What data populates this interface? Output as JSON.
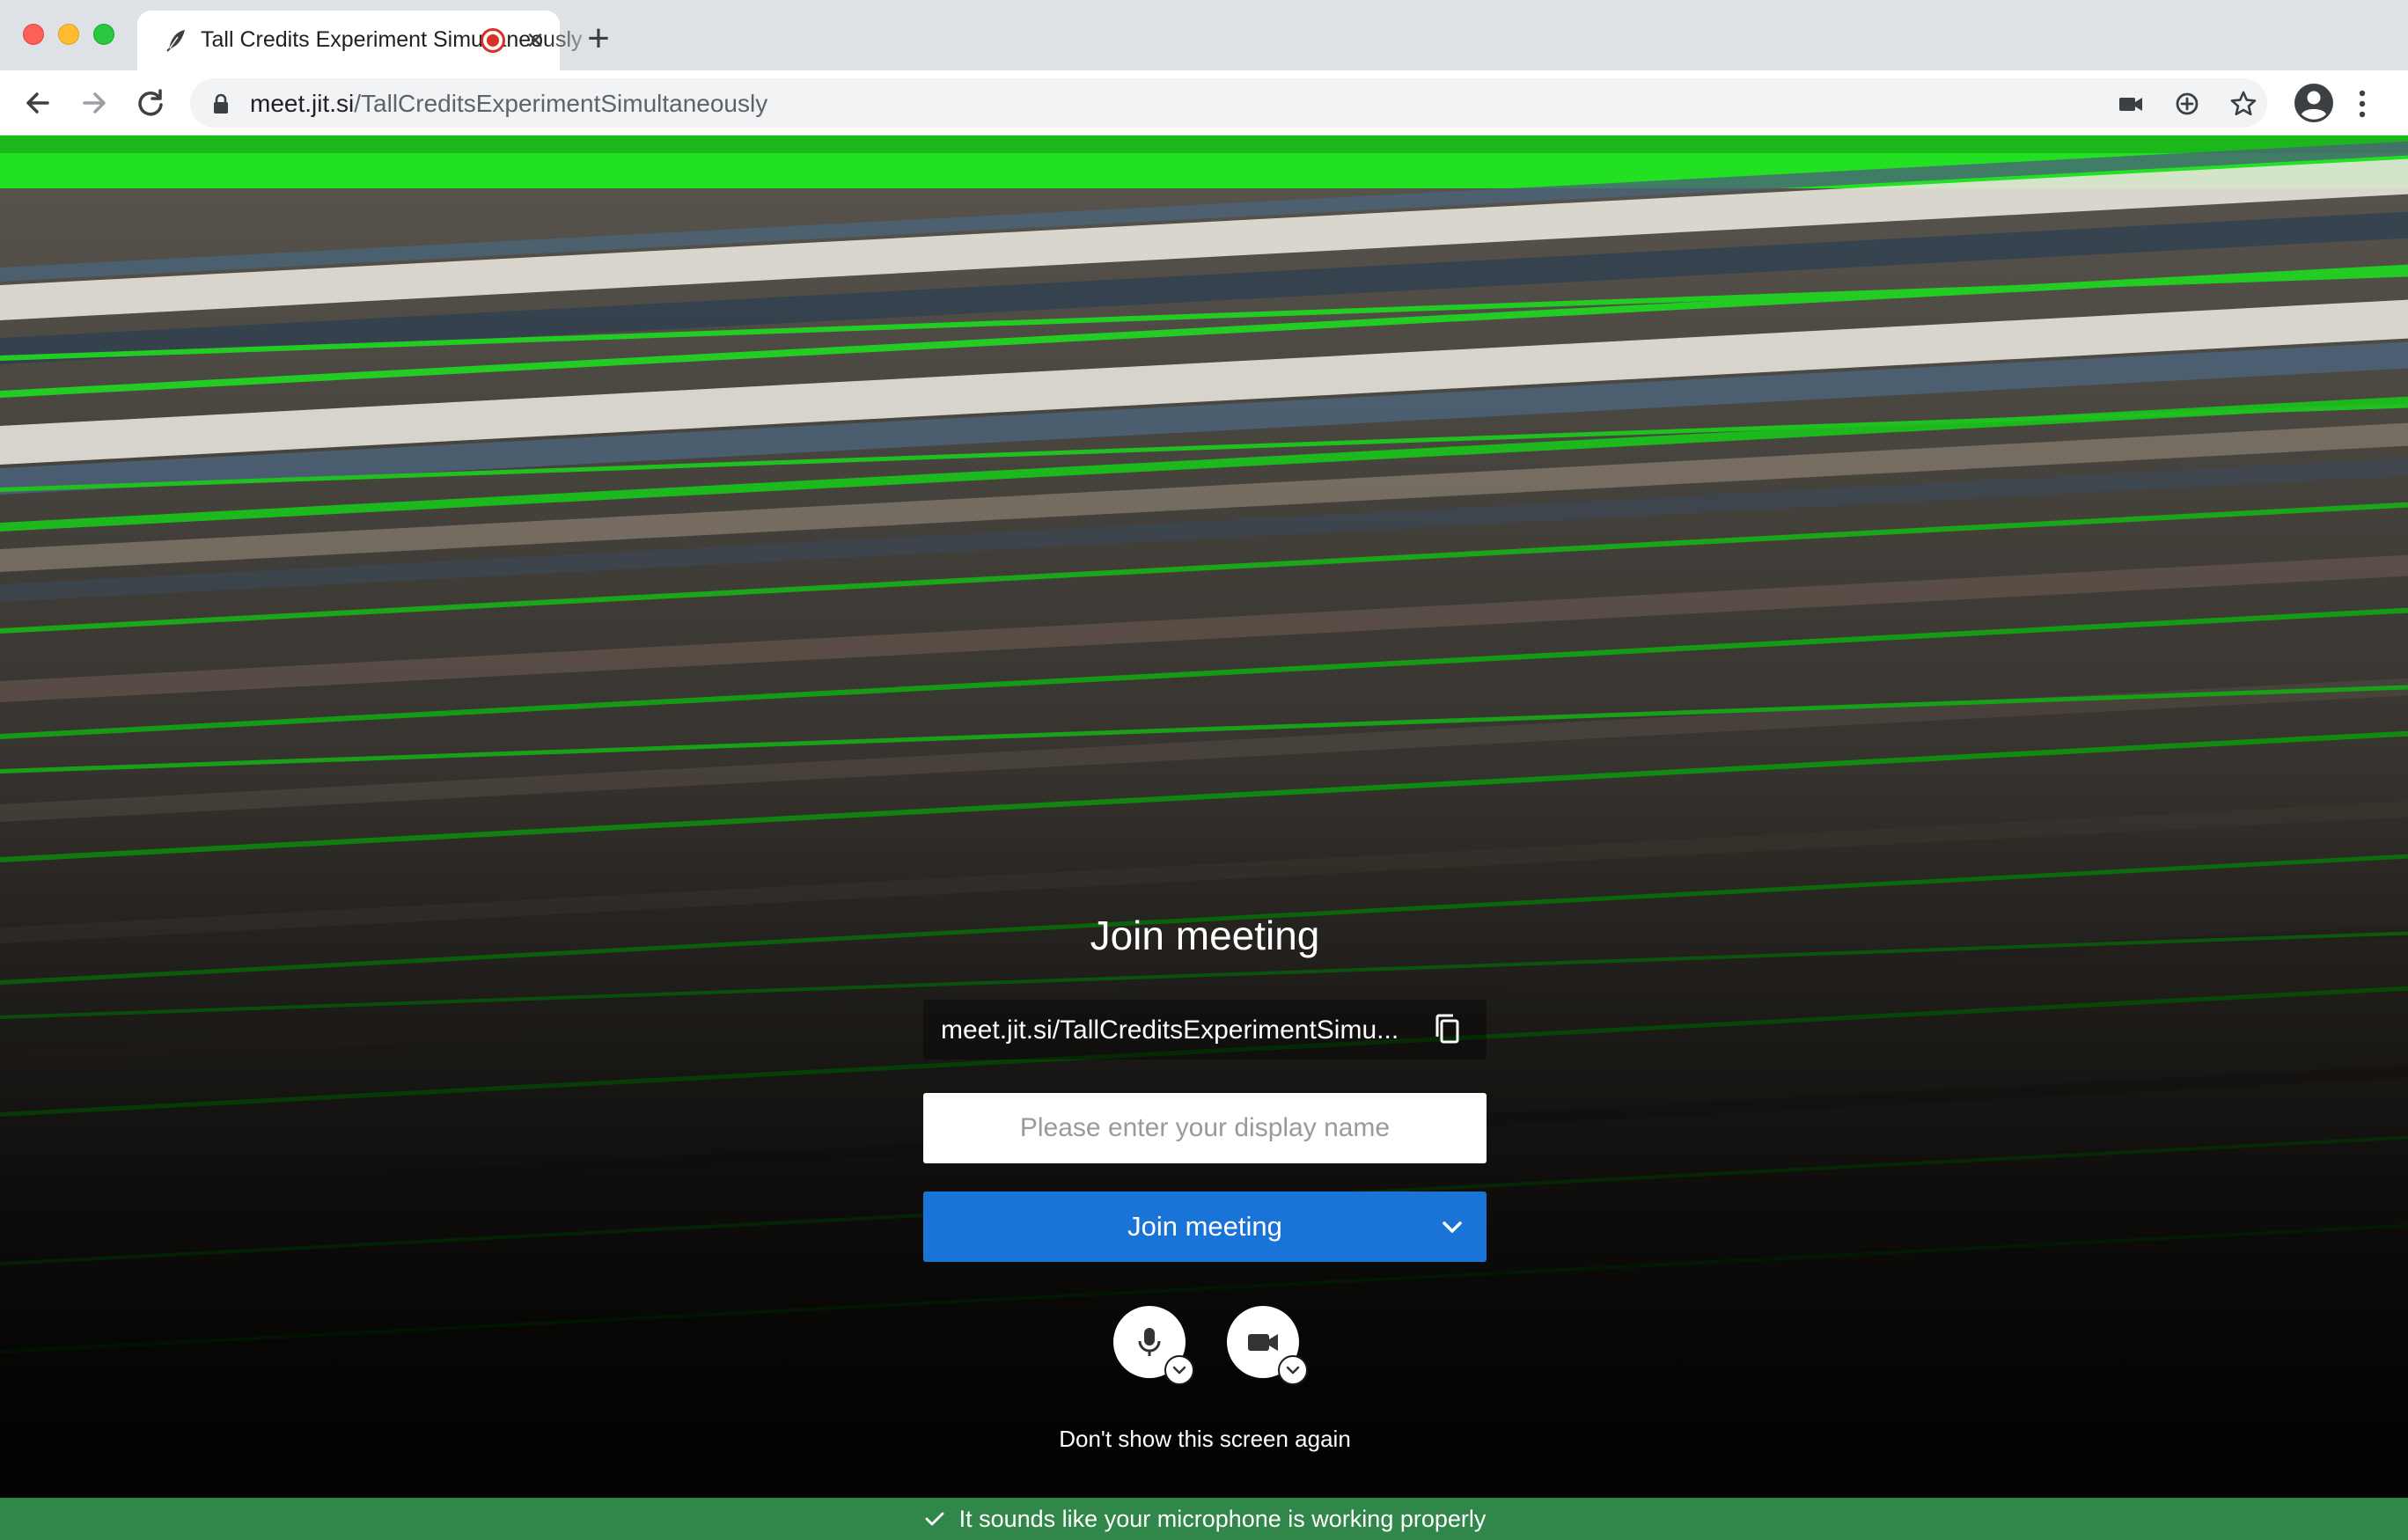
{
  "browser": {
    "tab": {
      "title": "Tall Credits Experiment Simultaneously",
      "close_icon": "×",
      "favicon": "jitsi-favicon-icon",
      "recording_indicator": "recording-dot-icon"
    },
    "new_tab_icon": "+",
    "address": {
      "host": "meet.jit.si",
      "path": "/TallCreditsExperimentSimultaneously"
    },
    "toolbar_icons": [
      "back-arrow-icon",
      "forward-arrow-icon",
      "reload-icon",
      "lock-icon",
      "camera-icon",
      "add-icon",
      "star-icon",
      "profile-icon",
      "kebab-menu-icon"
    ]
  },
  "prejoin": {
    "title": "Join meeting",
    "room_url": "meet.jit.si/TallCreditsExperimentSimu...",
    "name_placeholder": "Please enter your display name",
    "name_value": "",
    "join_label": "Join meeting",
    "dont_show": "Don't show this screen again",
    "mic_icon": "microphone-icon",
    "camera_icon": "video-camera-icon"
  },
  "notice": {
    "text": "It sounds like your microphone is working properly",
    "color": "#31874a"
  },
  "colors": {
    "join_button": "#1a73d6",
    "stripe_green": "#22dd22"
  }
}
